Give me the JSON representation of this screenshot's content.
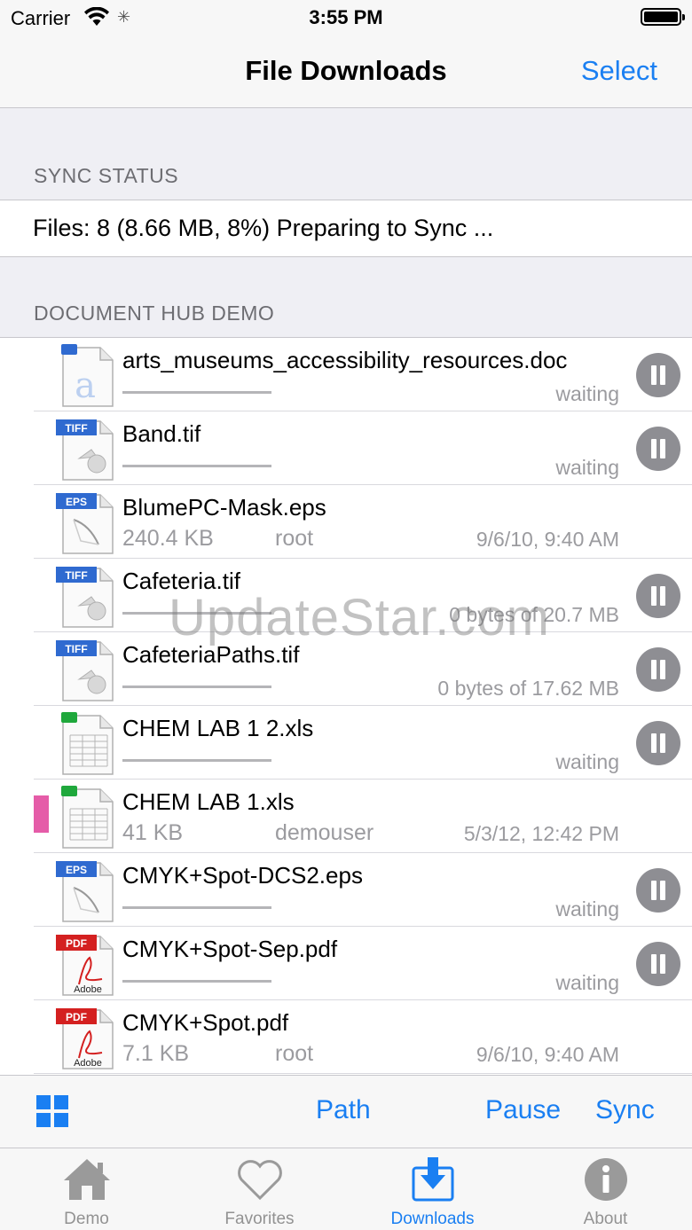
{
  "status_bar": {
    "carrier": "Carrier",
    "time": "3:55 PM"
  },
  "nav": {
    "title": "File Downloads",
    "select_label": "Select"
  },
  "sync_section": {
    "header": "SYNC STATUS",
    "status_text": "Files: 8 (8.66 MB, 8%) Preparing to Sync ..."
  },
  "doc_section": {
    "header": "DOCUMENT HUB DEMO"
  },
  "files": [
    {
      "name": "arts_museums_accessibility_resources.doc",
      "type": "doc",
      "status": "waiting",
      "state": "downloading"
    },
    {
      "name": "Band.tif",
      "type": "tiff",
      "status": "waiting",
      "state": "downloading"
    },
    {
      "name": "BlumePC-Mask.eps",
      "type": "eps",
      "size": "240.4 KB",
      "owner": "root",
      "date": "9/6/10, 9:40 AM",
      "state": "done"
    },
    {
      "name": "Cafeteria.tif",
      "type": "tiff",
      "status": "0 bytes of 20.7 MB",
      "state": "downloading"
    },
    {
      "name": "CafeteriaPaths.tif",
      "type": "tiff",
      "status": "0 bytes of 17.62 MB",
      "state": "downloading"
    },
    {
      "name": "CHEM LAB 1 2.xls",
      "type": "xls",
      "status": "waiting",
      "state": "downloading"
    },
    {
      "name": "CHEM LAB 1.xls",
      "type": "xls",
      "size": "41 KB",
      "owner": "demouser",
      "date": "5/3/12, 12:42 PM",
      "state": "done",
      "marker_color": "#e55ca8"
    },
    {
      "name": "CMYK+Spot-DCS2.eps",
      "type": "eps",
      "status": "waiting",
      "state": "downloading"
    },
    {
      "name": "CMYK+Spot-Sep.pdf",
      "type": "pdf",
      "status": "waiting",
      "state": "downloading"
    },
    {
      "name": "CMYK+Spot.pdf",
      "type": "pdf",
      "size": "7.1 KB",
      "owner": "root",
      "date": "9/6/10, 9:40 AM",
      "state": "done"
    }
  ],
  "icon_badges": {
    "tiff": "TIFF",
    "eps": "EPS",
    "pdf": "PDF",
    "pdf_brand": "Adobe"
  },
  "watermark": "UpdateStar.com",
  "toolbar": {
    "path_label": "Path",
    "pause_label": "Pause",
    "sync_label": "Sync"
  },
  "tabs": [
    {
      "label": "Demo",
      "icon": "house-icon"
    },
    {
      "label": "Favorites",
      "icon": "heart-icon"
    },
    {
      "label": "Downloads",
      "icon": "download-tray-icon",
      "active": true
    },
    {
      "label": "About",
      "icon": "info-icon"
    }
  ],
  "colors": {
    "accent": "#1a7ff2",
    "pause_button": "#8e8e93",
    "secondary_text": "#9b9b9f",
    "marker": "#e55ca8"
  }
}
